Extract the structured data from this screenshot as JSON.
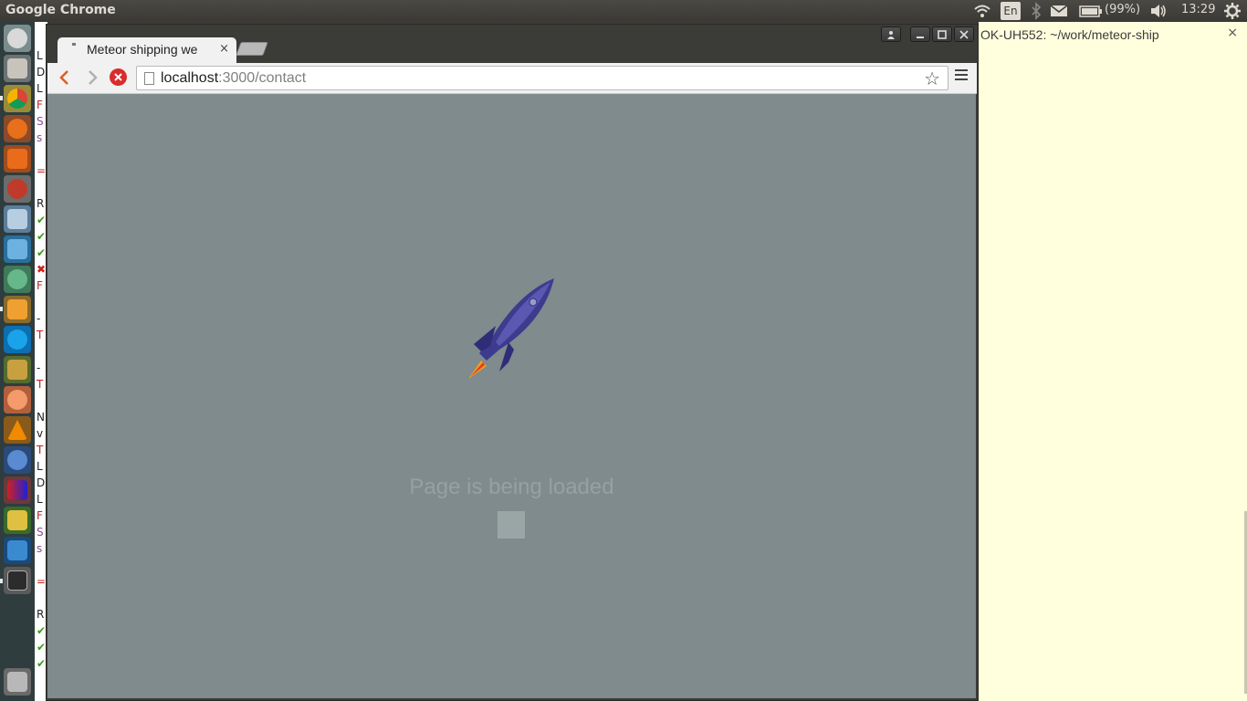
{
  "top_panel": {
    "app_name": "Google Chrome",
    "language": "En",
    "battery": "(99%)",
    "clock": "13:29"
  },
  "launcher": {
    "icons": [
      "ubuntu-dash-icon",
      "files-icon",
      "chrome-icon",
      "firefox-icon",
      "software-center-icon",
      "system-settings-icon",
      "workspaces-icon",
      "virtualbox-icon",
      "atom-icon",
      "sublime-text-icon",
      "skype-icon",
      "rhythmbox-icon",
      "orange-app-icon",
      "vlc-icon",
      "thunderbird-icon",
      "image-app-icon",
      "island-app-icon",
      "intellij-icon",
      "terminal-icon",
      "trash-icon"
    ]
  },
  "terminal_strip": {
    "lines": [
      "L",
      "D",
      "L",
      "F",
      "S",
      "s",
      "",
      "=",
      "",
      "R",
      "✔",
      "✔",
      "✔",
      "✖",
      "F",
      "",
      "-",
      "T",
      "",
      "-",
      "T",
      "",
      "N",
      "v",
      "T",
      "L",
      "D",
      "L",
      "F",
      "S",
      "s",
      "",
      "=",
      "",
      "R",
      "✔",
      "✔",
      "✔"
    ]
  },
  "right_pane": {
    "title": "OK-UH552: ~/work/meteor-ship",
    "close": "×"
  },
  "browser": {
    "tab_title": "Meteor shipping we",
    "tab_close": "×",
    "url_host": "localhost",
    "url_path": ":3000/contact",
    "star": "☆"
  },
  "page": {
    "loading_text": "Page is being loaded"
  },
  "colors": {
    "viewport_bg": "#7f8b8c",
    "rocket_body": "#3d3b8e",
    "right_pane_bg": "#ffffdd"
  }
}
